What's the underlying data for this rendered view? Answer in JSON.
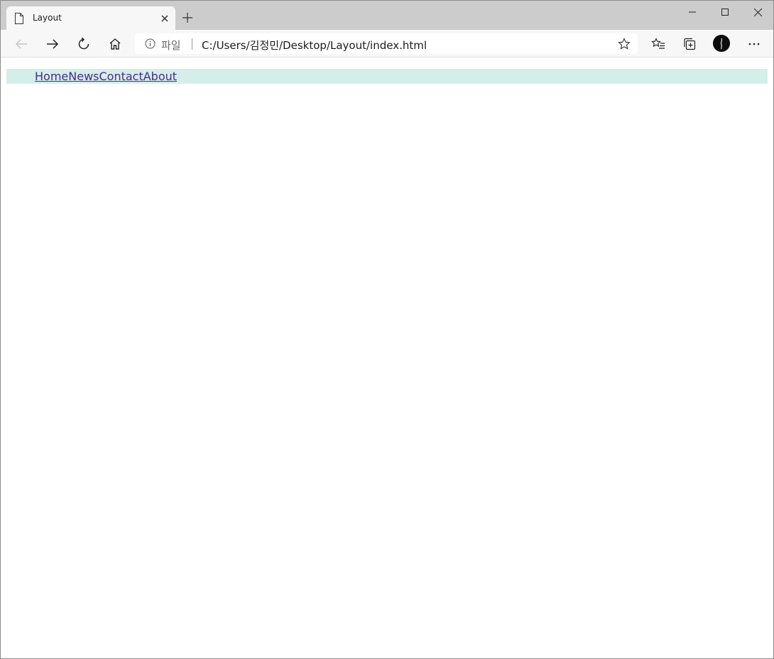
{
  "browser": {
    "tab": {
      "title": "Layout"
    },
    "address": {
      "scheme_label": "파일",
      "url": "C:/Users/김정민/Desktop/Layout/index.html"
    },
    "icons": {
      "page": "document-icon",
      "close_tab": "close-icon",
      "new_tab": "plus-icon",
      "minimize": "minimize-icon",
      "maximize": "maximize-icon",
      "close_window": "close-icon",
      "back": "back-arrow-icon",
      "forward": "forward-arrow-icon",
      "refresh": "refresh-icon",
      "home": "home-icon",
      "info": "info-icon",
      "favorite": "star-icon",
      "favorites": "favorites-list-icon",
      "collections": "collections-icon",
      "profile": "avatar",
      "menu": "more-icon"
    }
  },
  "page": {
    "nav": {
      "items": [
        {
          "label": "Home"
        },
        {
          "label": "News"
        },
        {
          "label": "Contact"
        },
        {
          "label": "About"
        }
      ],
      "background": "#d4eeea",
      "link_color": "#4b2a8a"
    }
  }
}
